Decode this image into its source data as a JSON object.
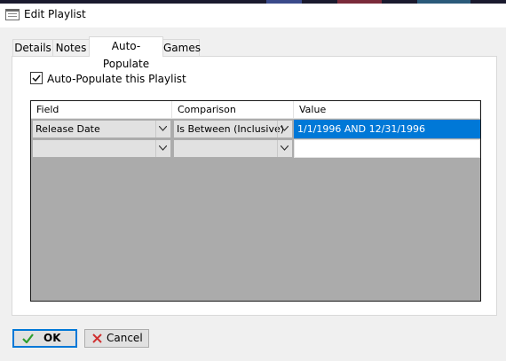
{
  "window": {
    "title": "Edit Playlist"
  },
  "tabs": [
    {
      "label": "Details"
    },
    {
      "label": "Notes"
    },
    {
      "label": "Auto-Populate",
      "active": true
    },
    {
      "label": "Games"
    }
  ],
  "auto_populate": {
    "checkbox_label": "Auto-Populate this Playlist",
    "checked": true
  },
  "grid": {
    "columns": [
      "Field",
      "Comparison",
      "Value"
    ],
    "rows": [
      {
        "field": "Release Date",
        "comparison": "Is Between (Inclusive)",
        "value": "1/1/1996 AND 12/31/1996",
        "selected": true
      },
      {
        "field": "",
        "comparison": "",
        "value": "",
        "selected": false
      }
    ]
  },
  "buttons": {
    "ok": "OK",
    "cancel": "Cancel"
  },
  "icons": {
    "title": "dialog-window-icon",
    "ok": "checkmark-icon",
    "cancel": "x-icon",
    "combo": "chevron-down-icon"
  },
  "colors": {
    "selection": "#0078d7",
    "grid_background": "#ababab",
    "ok_check": "#2e9e2e",
    "cancel_x": "#d03030"
  }
}
